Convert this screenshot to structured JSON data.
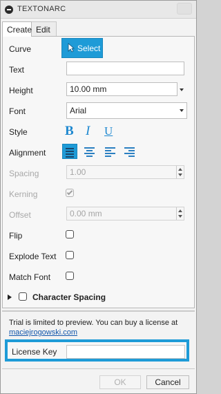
{
  "window": {
    "title": "TEXTONARC"
  },
  "tabs": [
    {
      "label": "Create"
    },
    {
      "label": "Edit"
    }
  ],
  "form": {
    "curve_label": "Curve",
    "select_label": "Select",
    "text_label": "Text",
    "text_value": "",
    "height_label": "Height",
    "height_value": "10.00 mm",
    "font_label": "Font",
    "font_value": "Arial",
    "style_label": "Style",
    "style_buttons": [
      {
        "glyph": "B",
        "icon": "bold-icon"
      },
      {
        "glyph": "I",
        "icon": "italic-icon"
      },
      {
        "glyph": "U",
        "icon": "underline-icon"
      }
    ],
    "alignment_label": "Alignment",
    "alignment_buttons": [
      "align-justify-icon",
      "align-center-icon",
      "align-left-icon",
      "align-right-icon"
    ],
    "spacing_label": "Spacing",
    "spacing_value": "1.00",
    "kerning_label": "Kerning",
    "offset_label": "Offset",
    "offset_value": "0.00 mm",
    "flip_label": "Flip",
    "explode_label": "Explode Text",
    "match_font_label": "Match Font",
    "character_spacing_label": "Character Spacing"
  },
  "license": {
    "trial_text": "Trial is limited to preview. You can buy a license at",
    "link_text": "maciejrogowski.com",
    "key_label": "License Key",
    "key_value": ""
  },
  "buttons": {
    "ok_label": "OK",
    "cancel_label": "Cancel"
  },
  "colors": {
    "accent": "#1e9bd7",
    "link": "#1155aa"
  }
}
